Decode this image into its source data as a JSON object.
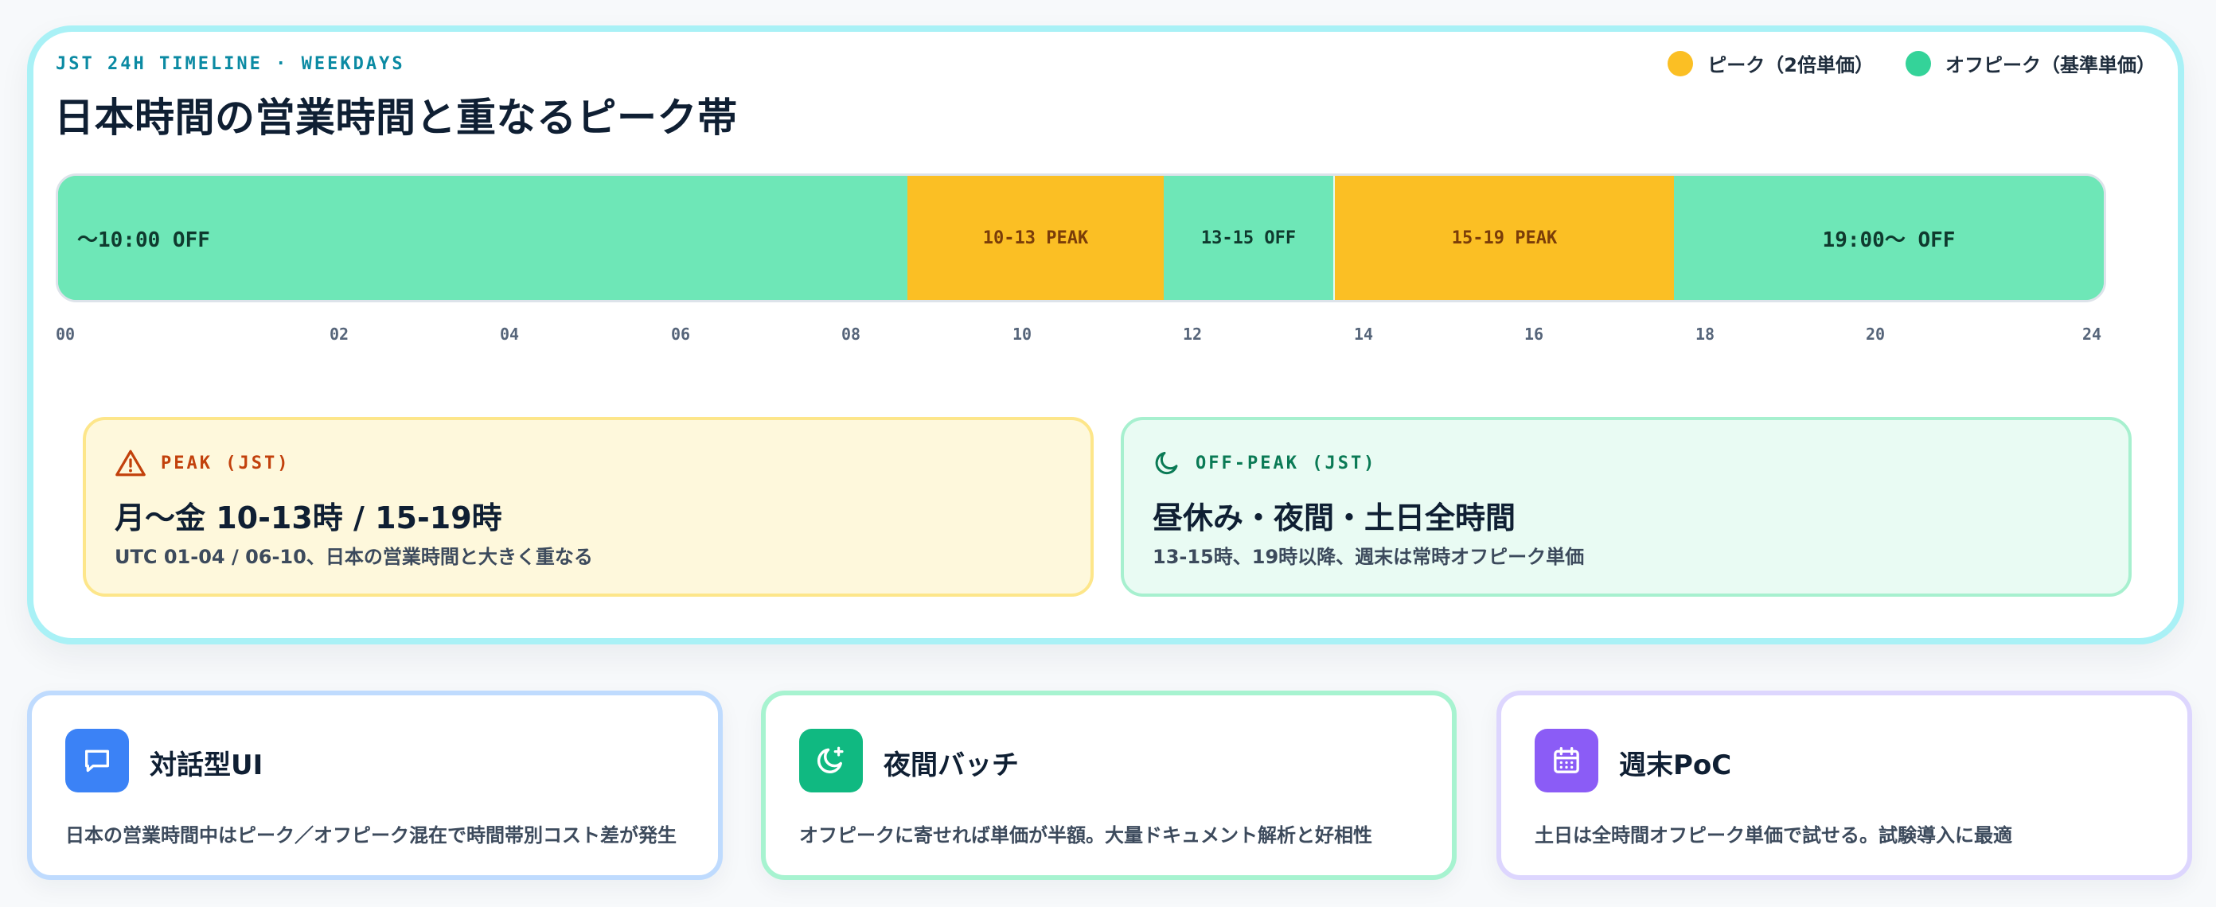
{
  "header": {
    "eyebrow": "JST 24H TIMELINE · WEEKDAYS",
    "title": "日本時間の営業時間と重なるピーク帯"
  },
  "legend": {
    "peak": "ピーク（2倍単価）",
    "offpeak": "オフピーク（基準単価）"
  },
  "colors": {
    "peak": "#fbbf24",
    "offpeak": "#6ee7b7",
    "card_border": "#a9f1f6"
  },
  "timeline": {
    "segments": [
      {
        "label": "〜10:00 OFF",
        "start": 0,
        "end": 9,
        "kind": "off"
      },
      {
        "label": "10-13 PEAK",
        "start": 9,
        "end": 12,
        "kind": "peak"
      },
      {
        "label": "13-15 OFF",
        "start": 12,
        "end": 14,
        "kind": "off"
      },
      {
        "label": "15-19 PEAK",
        "start": 14,
        "end": 18,
        "kind": "peak"
      },
      {
        "label": "19:00〜 OFF",
        "start": 18,
        "end": 24,
        "kind": "off"
      }
    ],
    "ticks": [
      "00",
      "02",
      "04",
      "06",
      "08",
      "10",
      "12",
      "14",
      "16",
      "18",
      "20",
      "24"
    ]
  },
  "peak_card": {
    "heading": "PEAK (JST)",
    "title": "月〜金 10-13時 / 15-19時",
    "desc": "UTC 01-04 / 06-10、日本の営業時間と大きく重なる"
  },
  "offpeak_card": {
    "heading": "OFF-PEAK (JST)",
    "title": "昼休み・夜間・土日全時間",
    "desc": "13-15時、19時以降、週末は常時オフピーク単価"
  },
  "cards": [
    {
      "icon": "chat-icon",
      "title": "対話型UI",
      "desc": "日本の営業時間中はピーク／オフピーク混在で時間帯別コスト差が発生"
    },
    {
      "icon": "moon-sparkle-icon",
      "title": "夜間バッチ",
      "desc": "オフピークに寄せれば単価が半額。大量ドキュメント解析と好相性"
    },
    {
      "icon": "calendar-icon",
      "title": "週末PoC",
      "desc": "土日は全時間オフピーク単価で試せる。試験導入に最適"
    }
  ]
}
